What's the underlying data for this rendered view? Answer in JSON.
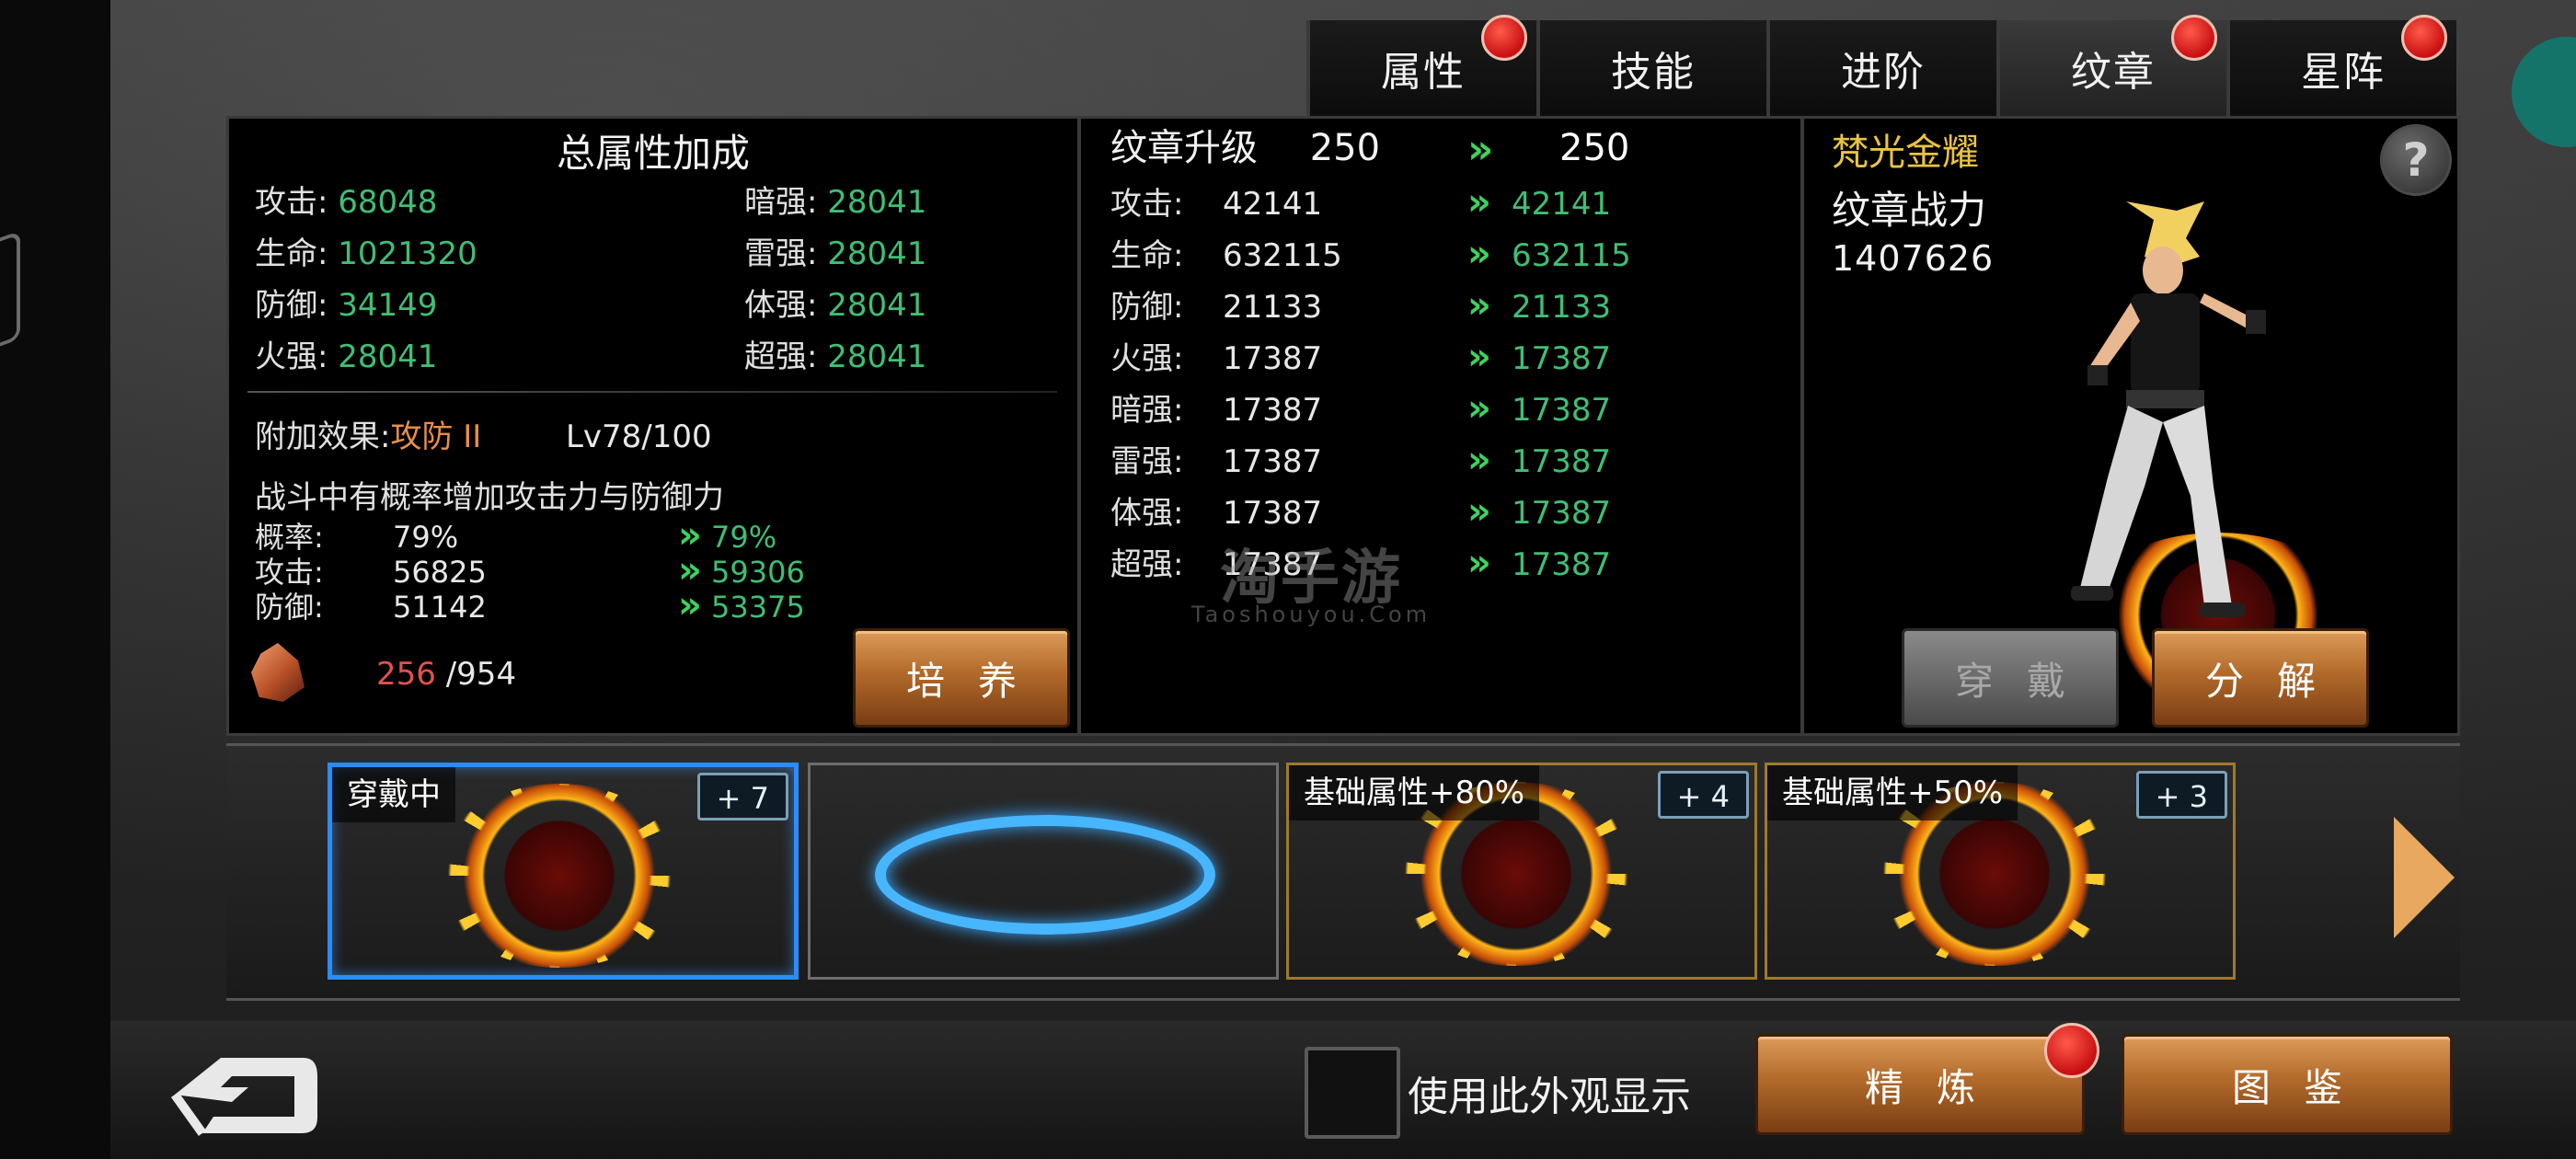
{
  "tabs": [
    {
      "label": "属性",
      "active": false,
      "badge": true
    },
    {
      "label": "技能",
      "active": false,
      "badge": false
    },
    {
      "label": "进阶",
      "active": false,
      "badge": false
    },
    {
      "label": "纹章",
      "active": true,
      "badge": true
    },
    {
      "label": "星阵",
      "active": false,
      "badge": true
    }
  ],
  "left": {
    "title": "总属性加成",
    "stats_left": [
      {
        "label": "攻击:",
        "value": "68048"
      },
      {
        "label": "生命:",
        "value": "1021320"
      },
      {
        "label": "防御:",
        "value": "34149"
      },
      {
        "label": "火强:",
        "value": "28041"
      }
    ],
    "stats_right": [
      {
        "label": "暗强:",
        "value": "28041"
      },
      {
        "label": "雷强:",
        "value": "28041"
      },
      {
        "label": "体强:",
        "value": "28041"
      },
      {
        "label": "超强:",
        "value": "28041"
      }
    ],
    "effect_label": "附加效果:",
    "effect_name": "攻防 II",
    "effect_level": "Lv78/100",
    "effect_desc": "战斗中有概率增加攻击力与防御力",
    "effect_rows": [
      {
        "label": "概率:",
        "current": "79%",
        "next": "79%"
      },
      {
        "label": "攻击:",
        "current": "56825",
        "next": "59306"
      },
      {
        "label": "防御:",
        "current": "51142",
        "next": "53375"
      }
    ],
    "crystal_current": "256",
    "crystal_total": "/954",
    "cultivate_button": "培养"
  },
  "mid": {
    "head_label": "纹章升级",
    "head_current": "250",
    "head_next": "250",
    "rows": [
      {
        "label": "攻击:",
        "current": "42141",
        "next": "42141"
      },
      {
        "label": "生命:",
        "current": "632115",
        "next": "632115"
      },
      {
        "label": "防御:",
        "current": "21133",
        "next": "21133"
      },
      {
        "label": "火强:",
        "current": "17387",
        "next": "17387"
      },
      {
        "label": "暗强:",
        "current": "17387",
        "next": "17387"
      },
      {
        "label": "雷强:",
        "current": "17387",
        "next": "17387"
      },
      {
        "label": "体强:",
        "current": "17387",
        "next": "17387"
      },
      {
        "label": "超强:",
        "current": "17387",
        "next": "17387"
      }
    ],
    "watermark": "淘手游",
    "watermark_sub": "Taoshouyou.Com"
  },
  "right": {
    "name": "梵光金耀",
    "power_label": "纹章战力",
    "power_value": "1407626",
    "help": "?",
    "wear_button": "穿戴",
    "decompose_button": "分解"
  },
  "slots": [
    {
      "label": "穿戴中",
      "level": "+ 7",
      "type": "crest",
      "selected": true
    },
    {
      "label": "",
      "level": "",
      "type": "empty",
      "selected": false
    },
    {
      "label": "基础属性+80%",
      "level": "+ 4",
      "type": "crest",
      "selected": false
    },
    {
      "label": "基础属性+50%",
      "level": "+ 3",
      "type": "crest",
      "selected": false
    }
  ],
  "bottom": {
    "use_appearance_label": "使用此外观显示",
    "refine_button": "精炼",
    "atlas_button": "图鉴"
  },
  "colors": {
    "stat_green": "#3fbf74",
    "arrow_green": "#3bd35e",
    "gold_name": "#e9c441",
    "effect_orange": "#e88e48",
    "crystal_red": "#e45050",
    "selected_blue": "#2a8cff"
  },
  "icons": [
    "back-arrow-icon",
    "help-icon",
    "crystal-icon",
    "next-arrow-icon",
    "double-chevron-icon"
  ]
}
